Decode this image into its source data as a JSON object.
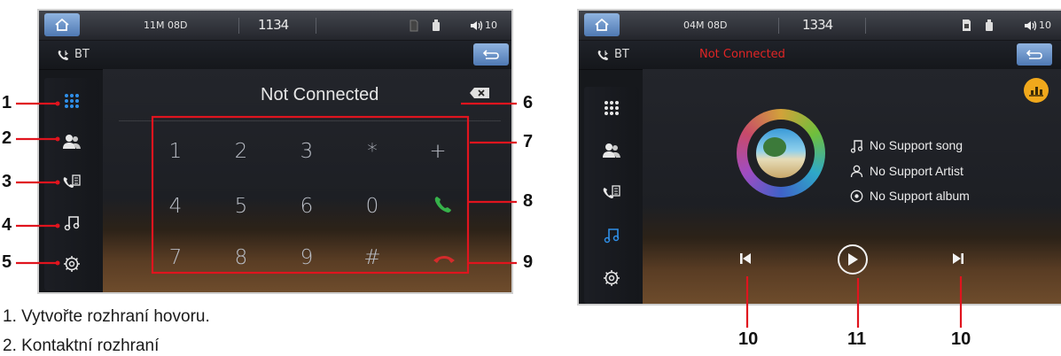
{
  "left_screen": {
    "status_bar": {
      "date": "11M 08D",
      "time": "1134",
      "volume": "10"
    },
    "bt_label": "BT",
    "display_text": "Not Connected",
    "keypad": [
      [
        "1",
        "2",
        "3",
        "*",
        "+"
      ],
      [
        "4",
        "5",
        "6",
        "0"
      ],
      [
        "7",
        "8",
        "9",
        "#"
      ]
    ]
  },
  "right_screen": {
    "status_bar": {
      "date": "04M 08D",
      "time": "1334",
      "volume": "10"
    },
    "bt_label": "BT",
    "connection_status": "Not Connected",
    "song": "No Support song",
    "artist": "No Support Artist",
    "album": "No Support album"
  },
  "callouts_left": [
    "1",
    "2",
    "3",
    "4",
    "5",
    "6",
    "7",
    "8",
    "9"
  ],
  "callouts_right": [
    "10",
    "11",
    "10"
  ],
  "captions": [
    "1. Vytvořte rozhraní hovoru.",
    "2. Kontaktní rozhraní"
  ],
  "colors": {
    "accent_blue": "#2f8fe8",
    "call_green": "#36b24a",
    "hangup_red": "#d42b2b",
    "callout_red": "#e0141e",
    "not_connected_red": "#e02525"
  }
}
